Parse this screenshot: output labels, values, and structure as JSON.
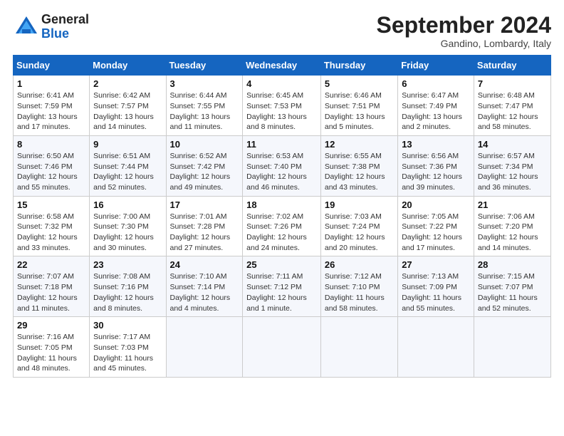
{
  "header": {
    "logo_general": "General",
    "logo_blue": "Blue",
    "month_title": "September 2024",
    "location": "Gandino, Lombardy, Italy"
  },
  "columns": [
    "Sunday",
    "Monday",
    "Tuesday",
    "Wednesday",
    "Thursday",
    "Friday",
    "Saturday"
  ],
  "weeks": [
    [
      {
        "day": "1",
        "info": "Sunrise: 6:41 AM\nSunset: 7:59 PM\nDaylight: 13 hours\nand 17 minutes."
      },
      {
        "day": "2",
        "info": "Sunrise: 6:42 AM\nSunset: 7:57 PM\nDaylight: 13 hours\nand 14 minutes."
      },
      {
        "day": "3",
        "info": "Sunrise: 6:44 AM\nSunset: 7:55 PM\nDaylight: 13 hours\nand 11 minutes."
      },
      {
        "day": "4",
        "info": "Sunrise: 6:45 AM\nSunset: 7:53 PM\nDaylight: 13 hours\nand 8 minutes."
      },
      {
        "day": "5",
        "info": "Sunrise: 6:46 AM\nSunset: 7:51 PM\nDaylight: 13 hours\nand 5 minutes."
      },
      {
        "day": "6",
        "info": "Sunrise: 6:47 AM\nSunset: 7:49 PM\nDaylight: 13 hours\nand 2 minutes."
      },
      {
        "day": "7",
        "info": "Sunrise: 6:48 AM\nSunset: 7:47 PM\nDaylight: 12 hours\nand 58 minutes."
      }
    ],
    [
      {
        "day": "8",
        "info": "Sunrise: 6:50 AM\nSunset: 7:46 PM\nDaylight: 12 hours\nand 55 minutes."
      },
      {
        "day": "9",
        "info": "Sunrise: 6:51 AM\nSunset: 7:44 PM\nDaylight: 12 hours\nand 52 minutes."
      },
      {
        "day": "10",
        "info": "Sunrise: 6:52 AM\nSunset: 7:42 PM\nDaylight: 12 hours\nand 49 minutes."
      },
      {
        "day": "11",
        "info": "Sunrise: 6:53 AM\nSunset: 7:40 PM\nDaylight: 12 hours\nand 46 minutes."
      },
      {
        "day": "12",
        "info": "Sunrise: 6:55 AM\nSunset: 7:38 PM\nDaylight: 12 hours\nand 43 minutes."
      },
      {
        "day": "13",
        "info": "Sunrise: 6:56 AM\nSunset: 7:36 PM\nDaylight: 12 hours\nand 39 minutes."
      },
      {
        "day": "14",
        "info": "Sunrise: 6:57 AM\nSunset: 7:34 PM\nDaylight: 12 hours\nand 36 minutes."
      }
    ],
    [
      {
        "day": "15",
        "info": "Sunrise: 6:58 AM\nSunset: 7:32 PM\nDaylight: 12 hours\nand 33 minutes."
      },
      {
        "day": "16",
        "info": "Sunrise: 7:00 AM\nSunset: 7:30 PM\nDaylight: 12 hours\nand 30 minutes."
      },
      {
        "day": "17",
        "info": "Sunrise: 7:01 AM\nSunset: 7:28 PM\nDaylight: 12 hours\nand 27 minutes."
      },
      {
        "day": "18",
        "info": "Sunrise: 7:02 AM\nSunset: 7:26 PM\nDaylight: 12 hours\nand 24 minutes."
      },
      {
        "day": "19",
        "info": "Sunrise: 7:03 AM\nSunset: 7:24 PM\nDaylight: 12 hours\nand 20 minutes."
      },
      {
        "day": "20",
        "info": "Sunrise: 7:05 AM\nSunset: 7:22 PM\nDaylight: 12 hours\nand 17 minutes."
      },
      {
        "day": "21",
        "info": "Sunrise: 7:06 AM\nSunset: 7:20 PM\nDaylight: 12 hours\nand 14 minutes."
      }
    ],
    [
      {
        "day": "22",
        "info": "Sunrise: 7:07 AM\nSunset: 7:18 PM\nDaylight: 12 hours\nand 11 minutes."
      },
      {
        "day": "23",
        "info": "Sunrise: 7:08 AM\nSunset: 7:16 PM\nDaylight: 12 hours\nand 8 minutes."
      },
      {
        "day": "24",
        "info": "Sunrise: 7:10 AM\nSunset: 7:14 PM\nDaylight: 12 hours\nand 4 minutes."
      },
      {
        "day": "25",
        "info": "Sunrise: 7:11 AM\nSunset: 7:12 PM\nDaylight: 12 hours\nand 1 minute."
      },
      {
        "day": "26",
        "info": "Sunrise: 7:12 AM\nSunset: 7:10 PM\nDaylight: 11 hours\nand 58 minutes."
      },
      {
        "day": "27",
        "info": "Sunrise: 7:13 AM\nSunset: 7:09 PM\nDaylight: 11 hours\nand 55 minutes."
      },
      {
        "day": "28",
        "info": "Sunrise: 7:15 AM\nSunset: 7:07 PM\nDaylight: 11 hours\nand 52 minutes."
      }
    ],
    [
      {
        "day": "29",
        "info": "Sunrise: 7:16 AM\nSunset: 7:05 PM\nDaylight: 11 hours\nand 48 minutes."
      },
      {
        "day": "30",
        "info": "Sunrise: 7:17 AM\nSunset: 7:03 PM\nDaylight: 11 hours\nand 45 minutes."
      },
      null,
      null,
      null,
      null,
      null
    ]
  ]
}
